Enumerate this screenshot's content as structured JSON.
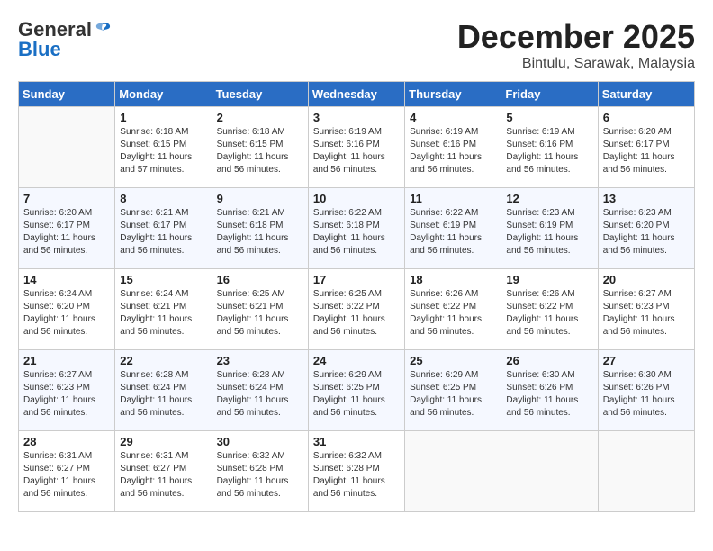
{
  "header": {
    "logo_general": "General",
    "logo_blue": "Blue",
    "month_title": "December 2025",
    "location": "Bintulu, Sarawak, Malaysia"
  },
  "weekdays": [
    "Sunday",
    "Monday",
    "Tuesday",
    "Wednesday",
    "Thursday",
    "Friday",
    "Saturday"
  ],
  "weeks": [
    [
      {
        "day": "",
        "sunrise": "",
        "sunset": "",
        "daylight": ""
      },
      {
        "day": "1",
        "sunrise": "6:18 AM",
        "sunset": "6:15 PM",
        "daylight": "11 hours and 57 minutes."
      },
      {
        "day": "2",
        "sunrise": "6:18 AM",
        "sunset": "6:15 PM",
        "daylight": "11 hours and 56 minutes."
      },
      {
        "day": "3",
        "sunrise": "6:19 AM",
        "sunset": "6:16 PM",
        "daylight": "11 hours and 56 minutes."
      },
      {
        "day": "4",
        "sunrise": "6:19 AM",
        "sunset": "6:16 PM",
        "daylight": "11 hours and 56 minutes."
      },
      {
        "day": "5",
        "sunrise": "6:19 AM",
        "sunset": "6:16 PM",
        "daylight": "11 hours and 56 minutes."
      },
      {
        "day": "6",
        "sunrise": "6:20 AM",
        "sunset": "6:17 PM",
        "daylight": "11 hours and 56 minutes."
      }
    ],
    [
      {
        "day": "7",
        "sunrise": "6:20 AM",
        "sunset": "6:17 PM",
        "daylight": "11 hours and 56 minutes."
      },
      {
        "day": "8",
        "sunrise": "6:21 AM",
        "sunset": "6:17 PM",
        "daylight": "11 hours and 56 minutes."
      },
      {
        "day": "9",
        "sunrise": "6:21 AM",
        "sunset": "6:18 PM",
        "daylight": "11 hours and 56 minutes."
      },
      {
        "day": "10",
        "sunrise": "6:22 AM",
        "sunset": "6:18 PM",
        "daylight": "11 hours and 56 minutes."
      },
      {
        "day": "11",
        "sunrise": "6:22 AM",
        "sunset": "6:19 PM",
        "daylight": "11 hours and 56 minutes."
      },
      {
        "day": "12",
        "sunrise": "6:23 AM",
        "sunset": "6:19 PM",
        "daylight": "11 hours and 56 minutes."
      },
      {
        "day": "13",
        "sunrise": "6:23 AM",
        "sunset": "6:20 PM",
        "daylight": "11 hours and 56 minutes."
      }
    ],
    [
      {
        "day": "14",
        "sunrise": "6:24 AM",
        "sunset": "6:20 PM",
        "daylight": "11 hours and 56 minutes."
      },
      {
        "day": "15",
        "sunrise": "6:24 AM",
        "sunset": "6:21 PM",
        "daylight": "11 hours and 56 minutes."
      },
      {
        "day": "16",
        "sunrise": "6:25 AM",
        "sunset": "6:21 PM",
        "daylight": "11 hours and 56 minutes."
      },
      {
        "day": "17",
        "sunrise": "6:25 AM",
        "sunset": "6:22 PM",
        "daylight": "11 hours and 56 minutes."
      },
      {
        "day": "18",
        "sunrise": "6:26 AM",
        "sunset": "6:22 PM",
        "daylight": "11 hours and 56 minutes."
      },
      {
        "day": "19",
        "sunrise": "6:26 AM",
        "sunset": "6:22 PM",
        "daylight": "11 hours and 56 minutes."
      },
      {
        "day": "20",
        "sunrise": "6:27 AM",
        "sunset": "6:23 PM",
        "daylight": "11 hours and 56 minutes."
      }
    ],
    [
      {
        "day": "21",
        "sunrise": "6:27 AM",
        "sunset": "6:23 PM",
        "daylight": "11 hours and 56 minutes."
      },
      {
        "day": "22",
        "sunrise": "6:28 AM",
        "sunset": "6:24 PM",
        "daylight": "11 hours and 56 minutes."
      },
      {
        "day": "23",
        "sunrise": "6:28 AM",
        "sunset": "6:24 PM",
        "daylight": "11 hours and 56 minutes."
      },
      {
        "day": "24",
        "sunrise": "6:29 AM",
        "sunset": "6:25 PM",
        "daylight": "11 hours and 56 minutes."
      },
      {
        "day": "25",
        "sunrise": "6:29 AM",
        "sunset": "6:25 PM",
        "daylight": "11 hours and 56 minutes."
      },
      {
        "day": "26",
        "sunrise": "6:30 AM",
        "sunset": "6:26 PM",
        "daylight": "11 hours and 56 minutes."
      },
      {
        "day": "27",
        "sunrise": "6:30 AM",
        "sunset": "6:26 PM",
        "daylight": "11 hours and 56 minutes."
      }
    ],
    [
      {
        "day": "28",
        "sunrise": "6:31 AM",
        "sunset": "6:27 PM",
        "daylight": "11 hours and 56 minutes."
      },
      {
        "day": "29",
        "sunrise": "6:31 AM",
        "sunset": "6:27 PM",
        "daylight": "11 hours and 56 minutes."
      },
      {
        "day": "30",
        "sunrise": "6:32 AM",
        "sunset": "6:28 PM",
        "daylight": "11 hours and 56 minutes."
      },
      {
        "day": "31",
        "sunrise": "6:32 AM",
        "sunset": "6:28 PM",
        "daylight": "11 hours and 56 minutes."
      },
      {
        "day": "",
        "sunrise": "",
        "sunset": "",
        "daylight": ""
      },
      {
        "day": "",
        "sunrise": "",
        "sunset": "",
        "daylight": ""
      },
      {
        "day": "",
        "sunrise": "",
        "sunset": "",
        "daylight": ""
      }
    ]
  ]
}
